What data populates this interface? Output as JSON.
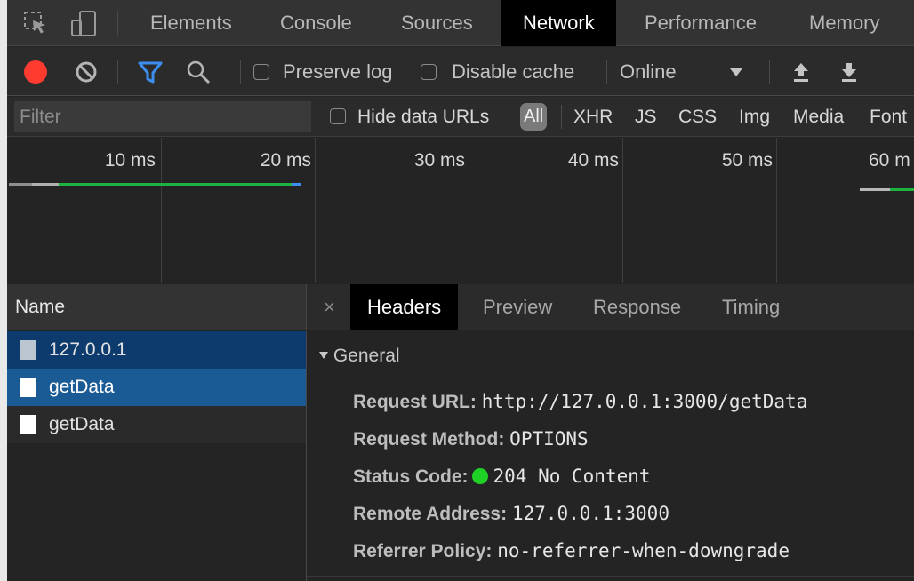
{
  "main_tabs": [
    "Elements",
    "Console",
    "Sources",
    "Network",
    "Performance",
    "Memory"
  ],
  "active_main_tab": "Network",
  "toolbar": {
    "preserve_log": "Preserve log",
    "disable_cache": "Disable cache",
    "throttling": "Online"
  },
  "filter": {
    "placeholder": "Filter",
    "hide_data_urls": "Hide data URLs",
    "types": [
      "All",
      "XHR",
      "JS",
      "CSS",
      "Img",
      "Media",
      "Font"
    ]
  },
  "timeline": {
    "ticks": [
      "10 ms",
      "20 ms",
      "30 ms",
      "40 ms",
      "50 ms",
      "60 m"
    ]
  },
  "request_list": {
    "header": "Name",
    "rows": [
      "127.0.0.1",
      "getData",
      "getData"
    ]
  },
  "detail_tabs": {
    "close": "×",
    "tabs": [
      "Headers",
      "Preview",
      "Response",
      "Timing"
    ],
    "active": "Headers"
  },
  "general": {
    "title": "General",
    "request_url_label": "Request URL:",
    "request_url": "http://127.0.0.1:3000/getData",
    "request_method_label": "Request Method:",
    "request_method": "OPTIONS",
    "status_code_label": "Status Code:",
    "status_code": "204 No Content",
    "remote_address_label": "Remote Address:",
    "remote_address": "127.0.0.1:3000",
    "referrer_policy_label": "Referrer Policy:",
    "referrer_policy": "no-referrer-when-downgrade"
  },
  "colors": {
    "record": "#ff3b30",
    "filter_active": "#3e8ef0",
    "status_ok": "#1fd027",
    "selected_row": "#1b5b95"
  }
}
